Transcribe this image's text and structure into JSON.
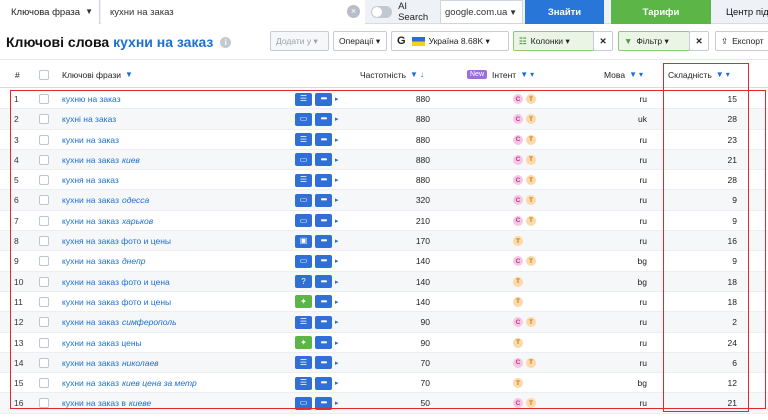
{
  "topbar": {
    "mode_label": "Ключова фраза",
    "query_value": "кухни на заказ",
    "ai_search_label": "AI Search",
    "database_value": "google.com.ua",
    "find_button": "Знайти",
    "tariffs_button": "Тарифи",
    "help_label": "Центр підтримки"
  },
  "title": {
    "prefix": "Ключові слова",
    "keyword": "кухни на заказ"
  },
  "toolbar": {
    "add_label": "Додати у",
    "operations_label": "Операції",
    "db_letter": "G",
    "db_label": "Україна 8.68K",
    "columns_label": "Колонки",
    "filter_label": "Фільтр",
    "export_label": "Експорт"
  },
  "columns": {
    "num": "#",
    "keywords": "Ключові фрази",
    "volume": "Частотність",
    "new_badge": "New",
    "intent": "Інтент",
    "language": "Мова",
    "difficulty": "Складність"
  },
  "rows": [
    {
      "n": "1",
      "kw": "кухню на заказ",
      "extra": "",
      "icon": "list",
      "intent": [
        "C",
        "T"
      ],
      "volume": "880",
      "lang": "ru",
      "diff": "15"
    },
    {
      "n": "2",
      "kw": "кухні на заказ",
      "extra": "",
      "icon": "chat",
      "intent": [
        "C",
        "T"
      ],
      "volume": "880",
      "lang": "uk",
      "diff": "28"
    },
    {
      "n": "3",
      "kw": "кухни на заказ",
      "extra": "",
      "icon": "list",
      "intent": [
        "C",
        "T"
      ],
      "volume": "880",
      "lang": "ru",
      "diff": "23"
    },
    {
      "n": "4",
      "kw": "кухни на заказ",
      "extra": "киев",
      "icon": "chat",
      "intent": [
        "C",
        "T"
      ],
      "volume": "880",
      "lang": "ru",
      "diff": "21"
    },
    {
      "n": "5",
      "kw": "кухня на заказ",
      "extra": "",
      "icon": "list",
      "intent": [
        "C",
        "T"
      ],
      "volume": "880",
      "lang": "ru",
      "diff": "28"
    },
    {
      "n": "6",
      "kw": "кухни на заказ",
      "extra": "одесса",
      "icon": "chat",
      "intent": [
        "C",
        "T"
      ],
      "volume": "320",
      "lang": "ru",
      "diff": "9"
    },
    {
      "n": "7",
      "kw": "кухни на заказ",
      "extra": "харьков",
      "icon": "chat",
      "intent": [
        "C",
        "T"
      ],
      "volume": "210",
      "lang": "ru",
      "diff": "9"
    },
    {
      "n": "8",
      "kw": "кухня на заказ фото и цены",
      "extra": "",
      "icon": "image",
      "intent": [
        "T"
      ],
      "volume": "170",
      "lang": "ru",
      "diff": "16"
    },
    {
      "n": "9",
      "kw": "кухни на заказ",
      "extra": "днепр",
      "icon": "chat",
      "intent": [
        "C",
        "T"
      ],
      "volume": "140",
      "lang": "bg",
      "diff": "9"
    },
    {
      "n": "10",
      "kw": "кухни на заказ фото и цена",
      "extra": "",
      "icon": "question",
      "intent": [
        "T"
      ],
      "volume": "140",
      "lang": "bg",
      "diff": "18"
    },
    {
      "n": "11",
      "kw": "кухни на заказ фото и цены",
      "extra": "",
      "icon": "star",
      "intent": [
        "T"
      ],
      "volume": "140",
      "lang": "ru",
      "diff": "18"
    },
    {
      "n": "12",
      "kw": "кухни на заказ",
      "extra": "симферополь",
      "icon": "list",
      "intent": [
        "C",
        "T"
      ],
      "volume": "90",
      "lang": "ru",
      "diff": "2"
    },
    {
      "n": "13",
      "kw": "кухни на заказ цены",
      "extra": "",
      "icon": "star",
      "intent": [
        "T"
      ],
      "volume": "90",
      "lang": "ru",
      "diff": "24"
    },
    {
      "n": "14",
      "kw": "кухни на заказ",
      "extra": "николаев",
      "icon": "list",
      "intent": [
        "C",
        "T"
      ],
      "volume": "70",
      "lang": "ru",
      "diff": "6"
    },
    {
      "n": "15",
      "kw": "кухни на заказ",
      "extra": "киев цена за метр",
      "icon": "list",
      "intent": [
        "T"
      ],
      "volume": "70",
      "lang": "bg",
      "diff": "12"
    },
    {
      "n": "16",
      "kw": "кухни на заказ в",
      "extra": "киеве",
      "icon": "chat",
      "intent": [
        "C",
        "T"
      ],
      "volume": "50",
      "lang": "ru",
      "diff": "21"
    }
  ],
  "colors": {
    "accent": "#1e6fd0",
    "find_button": "#2876d8",
    "tariff_button": "#5cb547",
    "highlight": "#e0282e"
  }
}
